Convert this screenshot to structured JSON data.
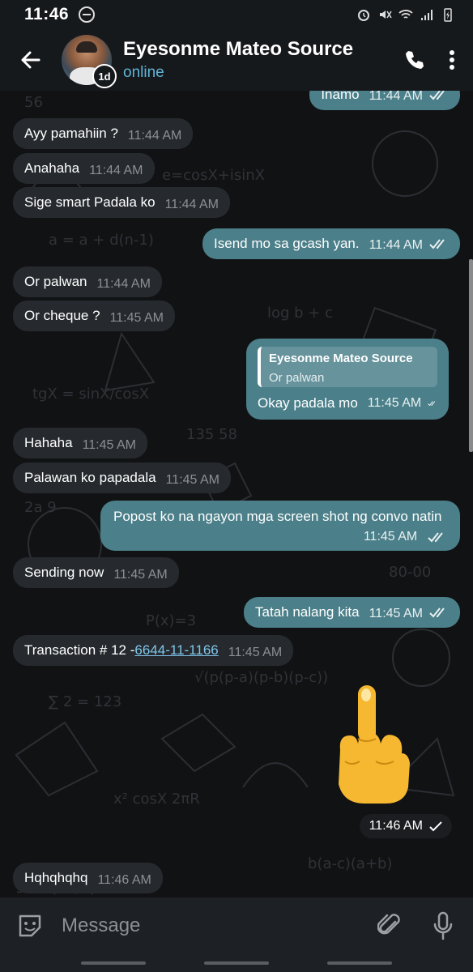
{
  "status_bar": {
    "time": "11:46"
  },
  "header": {
    "contact_name": "Eyesonme Mateo Source",
    "status": "online",
    "timer_label": "1d"
  },
  "messages": [
    {
      "dir": "out",
      "text": "Inamo",
      "time": "11:44 AM"
    },
    {
      "dir": "in",
      "text": "Ayy pamahiin ?",
      "time": "11:44 AM"
    },
    {
      "dir": "in",
      "text": "Anahaha",
      "time": "11:44 AM"
    },
    {
      "dir": "in",
      "text": "Sige smart Padala ko",
      "time": "11:44 AM"
    },
    {
      "dir": "out",
      "text": "Isend mo sa gcash yan.",
      "time": "11:44 AM"
    },
    {
      "dir": "in",
      "text": "Or palwan",
      "time": "11:44 AM"
    },
    {
      "dir": "in",
      "text": "Or cheque ?",
      "time": "11:45 AM"
    },
    {
      "dir": "out",
      "reply_author": "Eyesonme Mateo Source",
      "reply_text": "Or palwan",
      "text": "Okay padala mo",
      "time": "11:45 AM"
    },
    {
      "dir": "in",
      "text": "Hahaha",
      "time": "11:45 AM"
    },
    {
      "dir": "in",
      "text": "Palawan ko papadala",
      "time": "11:45 AM"
    },
    {
      "dir": "out",
      "text": "Popost ko na ngayon mga screen shot ng convo natin",
      "time": "11:45 AM"
    },
    {
      "dir": "in",
      "text": "Sending now",
      "time": "11:45 AM"
    },
    {
      "dir": "out",
      "text": "Tatah nalang kita",
      "time": "11:45 AM"
    },
    {
      "dir": "in",
      "text": "Transaction # 12 -",
      "link": "6644-11-1166",
      "time": "11:45 AM"
    },
    {
      "dir": "out",
      "sticker": "middle-finger-emoji",
      "time": "11:46 AM"
    },
    {
      "dir": "in",
      "text": "Hqhqhqhq",
      "time": "11:46 AM"
    }
  ],
  "input": {
    "placeholder": "Message"
  },
  "colors": {
    "outgoing_bubble": "#4b7f89",
    "incoming_bubble": "#262a2e",
    "accent": "#5fb4d8"
  }
}
